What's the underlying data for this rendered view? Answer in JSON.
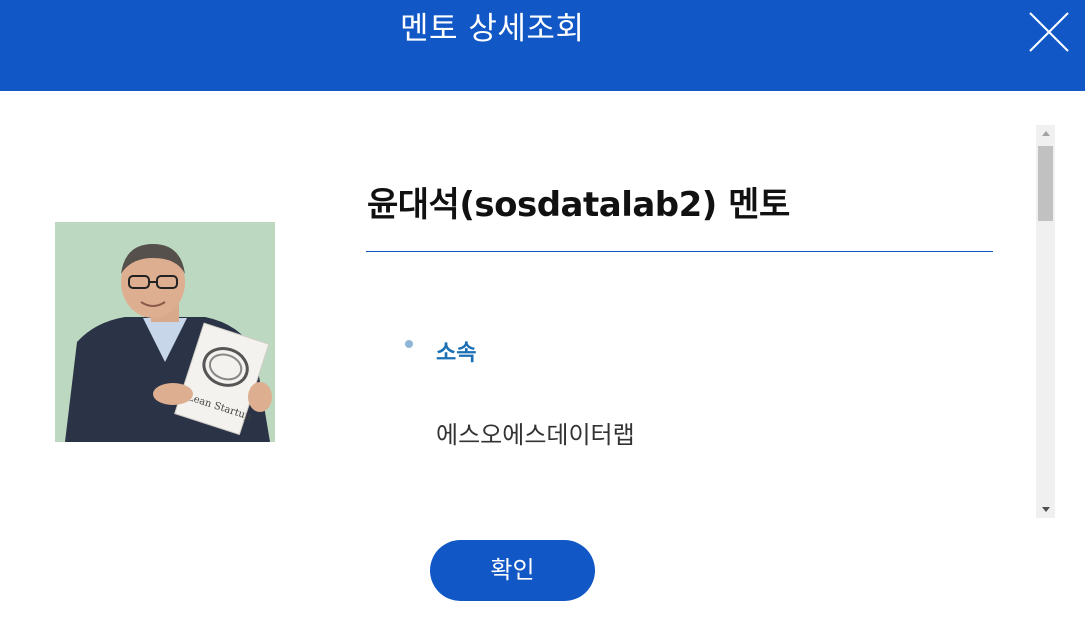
{
  "header": {
    "title": "멘토 상세조회",
    "close_icon": "close-icon"
  },
  "mentor": {
    "name_heading": "윤대석(sosdatalab2) 멘토",
    "photo_book_title": "Lean Startup"
  },
  "details": [
    {
      "label": "소속",
      "value": "에스오에스데이터랩"
    }
  ],
  "footer": {
    "confirm_label": "확인"
  },
  "colors": {
    "brand": "#1157c5",
    "label": "#1a6fb5",
    "bullet": "#8fb6d8"
  }
}
